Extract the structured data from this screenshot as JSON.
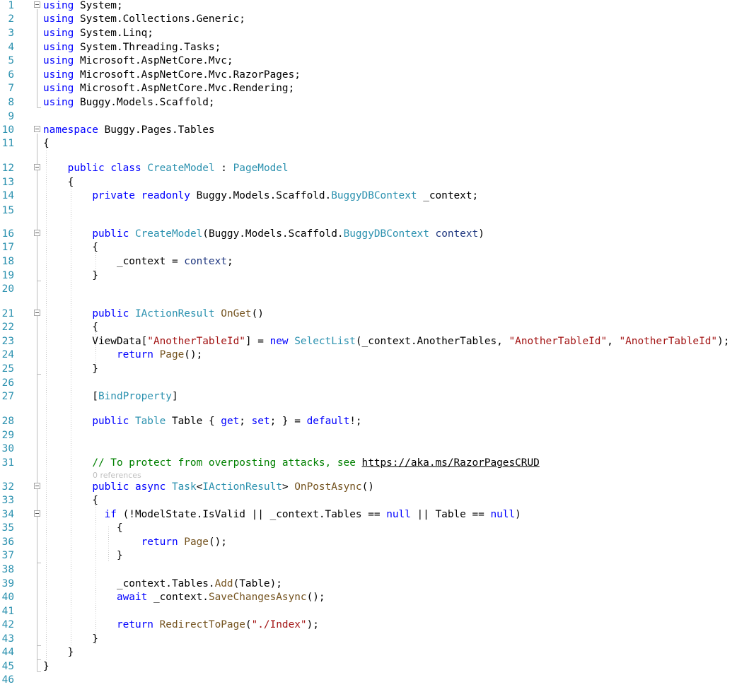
{
  "editor": {
    "codelens_label": "0 references",
    "colors": {
      "keyword": "#0000ff",
      "type": "#2b91af",
      "method": "#74531f",
      "string": "#a31515",
      "comment": "#008000",
      "line_number": "#2b91af"
    },
    "lines": [
      {
        "n": "1",
        "fold": true,
        "tokens": [
          [
            "kw",
            "using"
          ],
          [
            "tx",
            " System;"
          ]
        ]
      },
      {
        "n": "2",
        "tokens": [
          [
            "kw",
            "using"
          ],
          [
            "tx",
            " System.Collections.Generic;"
          ]
        ]
      },
      {
        "n": "3",
        "tokens": [
          [
            "kw",
            "using"
          ],
          [
            "tx",
            " System.Linq;"
          ]
        ]
      },
      {
        "n": "4",
        "tokens": [
          [
            "kw",
            "using"
          ],
          [
            "tx",
            " System.Threading.Tasks;"
          ]
        ]
      },
      {
        "n": "5",
        "tokens": [
          [
            "kw",
            "using"
          ],
          [
            "tx",
            " Microsoft.AspNetCore.Mvc;"
          ]
        ]
      },
      {
        "n": "6",
        "tokens": [
          [
            "kw",
            "using"
          ],
          [
            "tx",
            " Microsoft.AspNetCore.Mvc.RazorPages;"
          ]
        ]
      },
      {
        "n": "7",
        "tokens": [
          [
            "kw",
            "using"
          ],
          [
            "tx",
            " Microsoft.AspNetCore.Mvc.Rendering;"
          ]
        ]
      },
      {
        "n": "8",
        "tokens": [
          [
            "kw",
            "using"
          ],
          [
            "tx",
            " Buggy.Models.Scaffold;"
          ]
        ]
      },
      {
        "n": "9",
        "tokens": []
      },
      {
        "n": "10",
        "fold": true,
        "tokens": [
          [
            "kw",
            "namespace"
          ],
          [
            "tx",
            " Buggy.Pages.Tables"
          ]
        ]
      },
      {
        "n": "11",
        "tokens": [
          [
            "tx",
            "{"
          ]
        ]
      },
      {
        "n": "12",
        "fold": true,
        "tokens": [
          [
            "tx",
            "    "
          ],
          [
            "kw",
            "public"
          ],
          [
            "tx",
            " "
          ],
          [
            "kw",
            "class"
          ],
          [
            "tx",
            " "
          ],
          [
            "ty",
            "CreateModel"
          ],
          [
            "tx",
            " : "
          ],
          [
            "ty",
            "PageModel"
          ]
        ]
      },
      {
        "n": "13",
        "tokens": [
          [
            "tx",
            "    {"
          ]
        ]
      },
      {
        "n": "14",
        "tokens": [
          [
            "tx",
            "        "
          ],
          [
            "kw",
            "private"
          ],
          [
            "tx",
            " "
          ],
          [
            "kw",
            "readonly"
          ],
          [
            "tx",
            " Buggy.Models.Scaffold."
          ],
          [
            "ty",
            "BuggyDBContext"
          ],
          [
            "tx",
            " _context;"
          ]
        ]
      },
      {
        "n": "15",
        "tokens": []
      },
      {
        "n": "16",
        "fold": true,
        "tokens": [
          [
            "tx",
            "        "
          ],
          [
            "kw",
            "public"
          ],
          [
            "tx",
            " "
          ],
          [
            "ty",
            "CreateModel"
          ],
          [
            "tx",
            "(Buggy.Models.Scaffold."
          ],
          [
            "ty",
            "BuggyDBContext"
          ],
          [
            "tx",
            " "
          ],
          [
            "pm",
            "context"
          ],
          [
            "tx",
            ")"
          ]
        ]
      },
      {
        "n": "17",
        "tokens": [
          [
            "tx",
            "        {"
          ]
        ]
      },
      {
        "n": "18",
        "tokens": [
          [
            "tx",
            "            _context = "
          ],
          [
            "pm",
            "context"
          ],
          [
            "tx",
            ";"
          ]
        ]
      },
      {
        "n": "19",
        "tokens": [
          [
            "tx",
            "        }"
          ]
        ]
      },
      {
        "n": "20",
        "tokens": []
      },
      {
        "n": "21",
        "fold": true,
        "tokens": [
          [
            "tx",
            "        "
          ],
          [
            "kw",
            "public"
          ],
          [
            "tx",
            " "
          ],
          [
            "ty",
            "IActionResult"
          ],
          [
            "tx",
            " "
          ],
          [
            "me",
            "OnGet"
          ],
          [
            "tx",
            "()"
          ]
        ]
      },
      {
        "n": "22",
        "tokens": [
          [
            "tx",
            "        {"
          ]
        ]
      },
      {
        "n": "23",
        "tokens": [
          [
            "tx",
            "        ViewData["
          ],
          [
            "st",
            "\"AnotherTableId\""
          ],
          [
            "tx",
            "] = "
          ],
          [
            "kw",
            "new"
          ],
          [
            "tx",
            " "
          ],
          [
            "ty",
            "SelectList"
          ],
          [
            "tx",
            "(_context.AnotherTables, "
          ],
          [
            "st",
            "\"AnotherTableId\""
          ],
          [
            "tx",
            ", "
          ],
          [
            "st",
            "\"AnotherTableId\""
          ],
          [
            "tx",
            ");"
          ]
        ]
      },
      {
        "n": "24",
        "tokens": [
          [
            "tx",
            "            "
          ],
          [
            "kw",
            "return"
          ],
          [
            "tx",
            " "
          ],
          [
            "me",
            "Page"
          ],
          [
            "tx",
            "();"
          ]
        ]
      },
      {
        "n": "25",
        "tokens": [
          [
            "tx",
            "        }"
          ]
        ]
      },
      {
        "n": "26",
        "tokens": []
      },
      {
        "n": "27",
        "tokens": [
          [
            "tx",
            "        ["
          ],
          [
            "ty",
            "BindProperty"
          ],
          [
            "tx",
            "]"
          ]
        ]
      },
      {
        "n": "28",
        "tokens": [
          [
            "tx",
            "        "
          ],
          [
            "kw",
            "public"
          ],
          [
            "tx",
            " "
          ],
          [
            "ty",
            "Table"
          ],
          [
            "tx",
            " Table { "
          ],
          [
            "kw",
            "get"
          ],
          [
            "tx",
            "; "
          ],
          [
            "kw",
            "set"
          ],
          [
            "tx",
            "; } = "
          ],
          [
            "kw",
            "default"
          ],
          [
            "tx",
            "!;"
          ]
        ]
      },
      {
        "n": "29",
        "tokens": []
      },
      {
        "n": "30",
        "tokens": []
      },
      {
        "n": "31",
        "tokens": [
          [
            "tx",
            "        "
          ],
          [
            "cm",
            "// To protect from overposting attacks, see "
          ],
          [
            "lk",
            "https://aka.ms/RazorPagesCRUD"
          ]
        ]
      },
      {
        "n": "32",
        "fold": true,
        "tokens": [
          [
            "tx",
            "        "
          ],
          [
            "kw",
            "public"
          ],
          [
            "tx",
            " "
          ],
          [
            "kw",
            "async"
          ],
          [
            "tx",
            " "
          ],
          [
            "ty",
            "Task"
          ],
          [
            "tx",
            "<"
          ],
          [
            "ty",
            "IActionResult"
          ],
          [
            "tx",
            "> "
          ],
          [
            "me",
            "OnPostAsync"
          ],
          [
            "tx",
            "()"
          ]
        ]
      },
      {
        "n": "33",
        "tokens": [
          [
            "tx",
            "        {"
          ]
        ]
      },
      {
        "n": "34",
        "fold": true,
        "tokens": [
          [
            "tx",
            "          "
          ],
          [
            "kw",
            "if"
          ],
          [
            "tx",
            " (!ModelState.IsValid || _context.Tables == "
          ],
          [
            "kw",
            "null"
          ],
          [
            "tx",
            " || Table == "
          ],
          [
            "kw",
            "null"
          ],
          [
            "tx",
            ")"
          ]
        ]
      },
      {
        "n": "35",
        "tokens": [
          [
            "tx",
            "            {"
          ]
        ]
      },
      {
        "n": "36",
        "tokens": [
          [
            "tx",
            "                "
          ],
          [
            "kw",
            "return"
          ],
          [
            "tx",
            " "
          ],
          [
            "me",
            "Page"
          ],
          [
            "tx",
            "();"
          ]
        ]
      },
      {
        "n": "37",
        "tokens": [
          [
            "tx",
            "            }"
          ]
        ]
      },
      {
        "n": "38",
        "tokens": []
      },
      {
        "n": "39",
        "tokens": [
          [
            "tx",
            "            _context.Tables."
          ],
          [
            "me",
            "Add"
          ],
          [
            "tx",
            "(Table);"
          ]
        ]
      },
      {
        "n": "40",
        "tokens": [
          [
            "tx",
            "            "
          ],
          [
            "kw",
            "await"
          ],
          [
            "tx",
            " _context."
          ],
          [
            "me",
            "SaveChangesAsync"
          ],
          [
            "tx",
            "();"
          ]
        ]
      },
      {
        "n": "41",
        "tokens": []
      },
      {
        "n": "42",
        "tokens": [
          [
            "tx",
            "            "
          ],
          [
            "kw",
            "return"
          ],
          [
            "tx",
            " "
          ],
          [
            "me",
            "RedirectToPage"
          ],
          [
            "tx",
            "("
          ],
          [
            "st",
            "\"./Index\""
          ],
          [
            "tx",
            ");"
          ]
        ]
      },
      {
        "n": "43",
        "tokens": [
          [
            "tx",
            "        }"
          ]
        ]
      },
      {
        "n": "44",
        "tokens": [
          [
            "tx",
            "    }"
          ]
        ]
      },
      {
        "n": "45",
        "tokens": [
          [
            "tx",
            "}"
          ]
        ]
      },
      {
        "n": "46",
        "tokens": []
      }
    ]
  }
}
